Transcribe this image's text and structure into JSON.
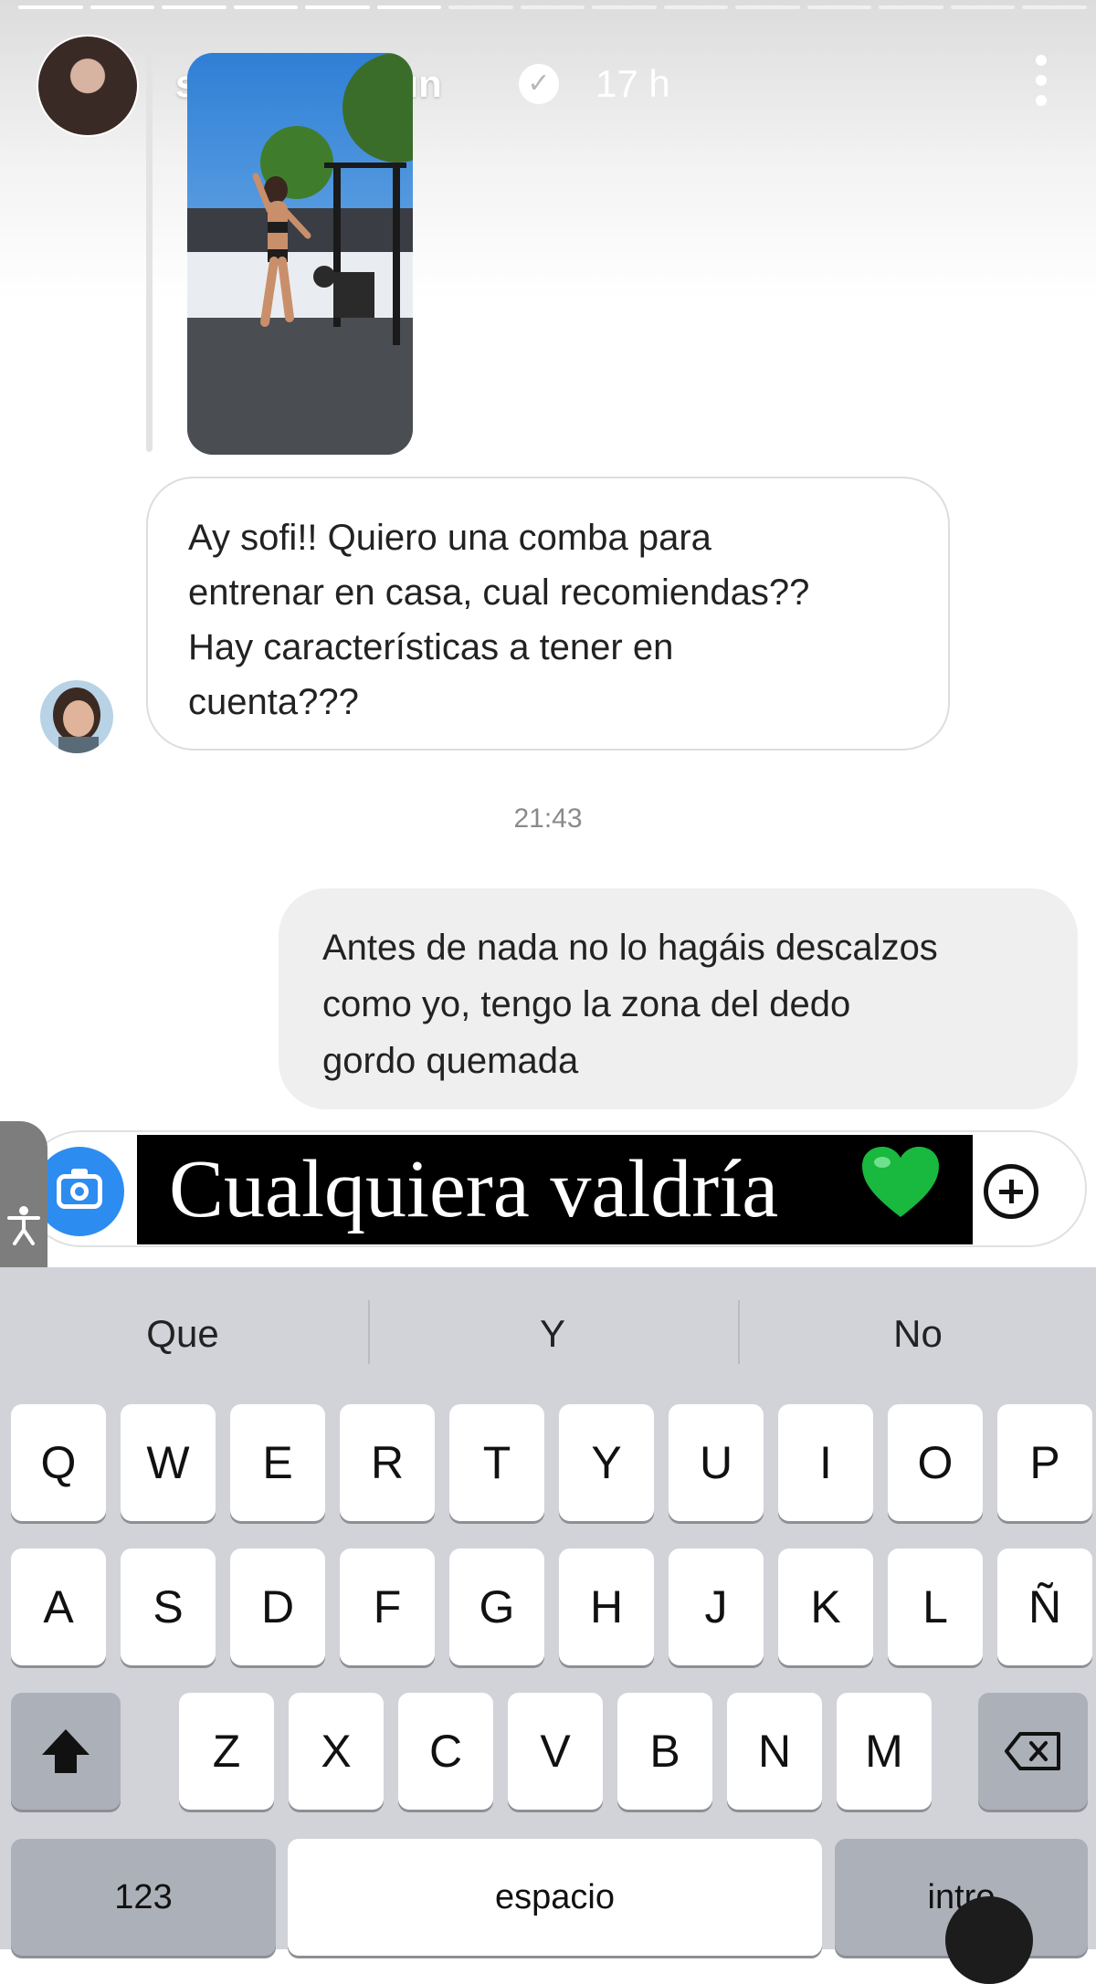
{
  "story": {
    "username": "sofia_suescun",
    "time_ago": "17 h",
    "progress_done": 6,
    "progress_total": 15
  },
  "icons": [
    "verified-icon",
    "more-icon",
    "camera-icon",
    "green-heart-icon",
    "plus-icon",
    "accessibility-icon",
    "shift-icon",
    "backspace-icon",
    "dictation-icon"
  ],
  "conversation": {
    "incoming_text": "Ay sofi!! Quiero una comba para\nentrenar en casa, cual recomiendas??\nHay características a tener en\ncuenta???",
    "timestamp": "21:43",
    "outgoing_text": "Antes de nada no lo hagáis descalzos\ncomo yo, tengo la zona del dedo\ngordo quemada"
  },
  "composer": {
    "overlay_text": "Cualquiera valdría",
    "heart_color": "#19b83f",
    "camera_color": "#2d8cf0"
  },
  "keyboard": {
    "suggestions": [
      "Que",
      "Y",
      "No"
    ],
    "row1": [
      "Q",
      "W",
      "E",
      "R",
      "T",
      "Y",
      "U",
      "I",
      "O",
      "P"
    ],
    "row2": [
      "A",
      "S",
      "D",
      "F",
      "G",
      "H",
      "J",
      "K",
      "L",
      "Ñ"
    ],
    "row3": [
      "Z",
      "X",
      "C",
      "V",
      "B",
      "N",
      "M"
    ],
    "numbers_label": "123",
    "space_label": "espacio",
    "return_label": "intro"
  }
}
